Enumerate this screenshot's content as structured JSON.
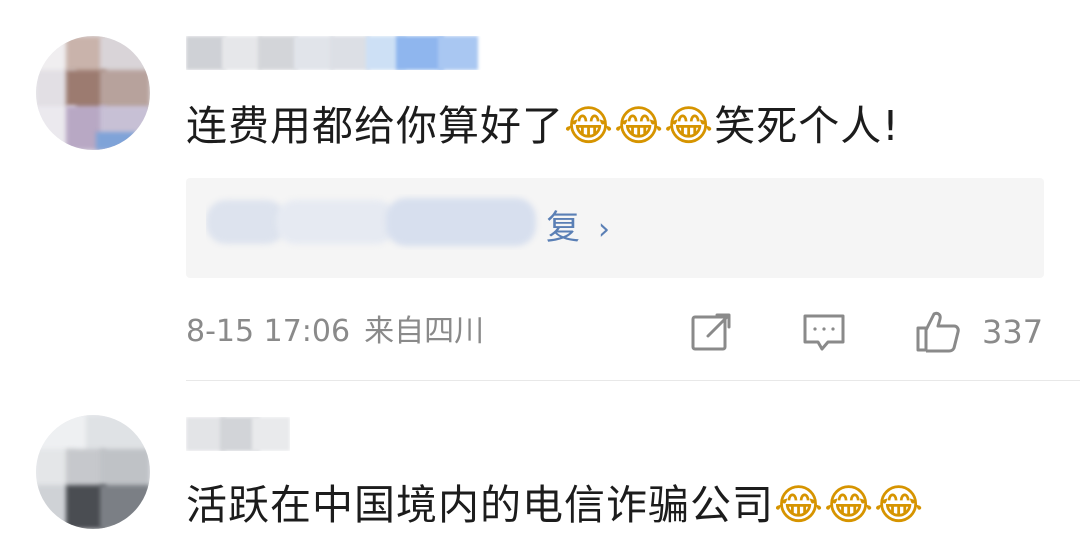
{
  "comments": [
    {
      "text": "连费用都给你算好了",
      "text_suffix": "笑死个人!",
      "emoji_icons": [
        "laughing-tears-emoji-icon",
        "laughing-tears-emoji-icon",
        "laughing-tears-emoji-icon"
      ],
      "reply": {
        "visible_text": "复",
        "chevron": "›"
      },
      "time": "8-15 17:06",
      "location": "来自四川",
      "likes": "337"
    },
    {
      "text": "活跃在中国境内的电信诈骗公司",
      "emoji_icons": [
        "laughing-tears-emoji-icon",
        "laughing-tears-emoji-icon",
        "laughing-tears-emoji-icon"
      ]
    }
  ],
  "colors": {
    "link": "#5a7fb5",
    "meta": "#8a8a8a",
    "reply_bg": "#f5f5f5"
  }
}
